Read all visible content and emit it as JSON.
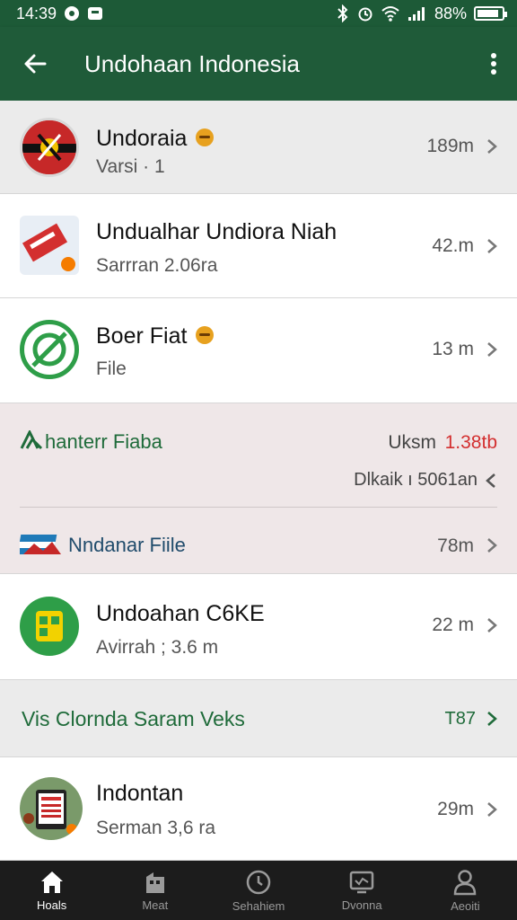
{
  "status": {
    "time": "14:39",
    "battery": "88%",
    "battery_level": 0.88
  },
  "header": {
    "title": "Undohaan Indonesia"
  },
  "items": [
    {
      "title": "Undoraia",
      "subtitle": "Varsi · 1",
      "size": "189m"
    },
    {
      "title": "Undualhar Undiora Niah",
      "subtitle": "Sarrran 2.06ra",
      "size": "42.m"
    },
    {
      "title": "Boer Fiat",
      "subtitle": "File",
      "size": "13 m"
    }
  ],
  "group": {
    "title": "hanterr Fiaba",
    "label": "Uksm",
    "value": "1.38tb",
    "detail": "Dlkaik ı 5061an",
    "file_title": "Nndanar Fiile",
    "file_size": "78m"
  },
  "item_cske": {
    "title": "Undoahan C6KE",
    "subtitle": "Avirrah ; 3.6 m",
    "size": "22 m"
  },
  "section": {
    "title": "Vis Clornda Saram Veks",
    "count": "T87"
  },
  "item_last": {
    "title": "Indontan",
    "subtitle": "Serman 3,6 ra",
    "size": "29m"
  },
  "nav": [
    {
      "label": "Hoals",
      "icon": "home-icon"
    },
    {
      "label": "Meat",
      "icon": "store-icon"
    },
    {
      "label": "Sehahiem",
      "icon": "clock-icon"
    },
    {
      "label": "Dvonna",
      "icon": "monitor-icon"
    },
    {
      "label": "Aeoiti",
      "icon": "person-icon"
    }
  ],
  "colors": {
    "primary": "#1f5b39",
    "accent_red": "#d32f2f",
    "green_text": "#1f6b3a",
    "blue_text": "#1f4b6b"
  }
}
